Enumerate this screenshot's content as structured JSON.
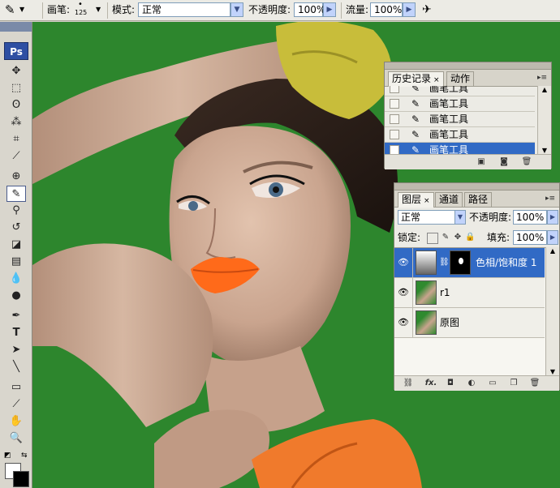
{
  "options_bar": {
    "brush_label": "画笔:",
    "brush_size": "125",
    "mode_label": "模式:",
    "mode_value": "正常",
    "opacity_label": "不透明度:",
    "opacity_value": "100%",
    "flow_label": "流量:",
    "flow_value": "100%"
  },
  "toolbox": {
    "logo": "Ps"
  },
  "history_panel": {
    "tabs": [
      {
        "label": "历史记录",
        "close": "×"
      },
      {
        "label": "动作"
      }
    ],
    "items": [
      {
        "label": "画笔工具"
      },
      {
        "label": "画笔工具"
      },
      {
        "label": "画笔工具"
      },
      {
        "label": "画笔工具"
      },
      {
        "label": "画笔工具",
        "selected": true
      }
    ]
  },
  "layers_panel": {
    "tabs": [
      {
        "label": "图层",
        "close": "×"
      },
      {
        "label": "通道"
      },
      {
        "label": "路径"
      }
    ],
    "blend_mode": "正常",
    "opacity_label": "不透明度:",
    "opacity_value": "100%",
    "lock_label": "锁定:",
    "fill_label": "填充:",
    "fill_value": "100%",
    "fx_label": "fx.",
    "layers": [
      {
        "name": "色相/饱和度 1",
        "selected": true,
        "type": "adjustment"
      },
      {
        "name": "r1",
        "selected": false,
        "type": "image"
      },
      {
        "name": "原图",
        "selected": false,
        "type": "image"
      }
    ]
  },
  "colors": {
    "canvas_green": "#2f8a2f",
    "selection_blue": "#316ac5",
    "lip_orange": "#ff6a1a",
    "glove_yellow": "#c8bd3a"
  }
}
